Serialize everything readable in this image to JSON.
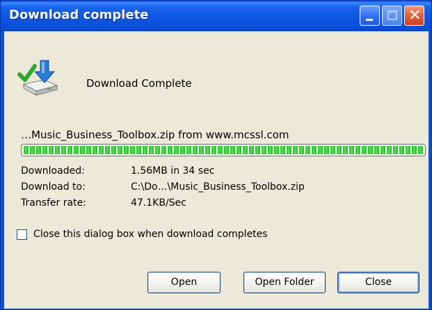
{
  "window": {
    "title": "Download complete",
    "controls": {
      "minimize_icon": "minimize-icon",
      "maximize_icon": "maximize-icon",
      "close_icon": "close-icon",
      "close_glyph": "✕"
    }
  },
  "dialog": {
    "icon": "download-complete-icon",
    "status": "Download Complete",
    "file_source": "…Music_Business_Toolbox.zip from www.mcssl.com",
    "progress": 1.0,
    "details": [
      {
        "label": "Downloaded:",
        "value": "1.56MB in 34 sec"
      },
      {
        "label": "Download to:",
        "value": "C:\\Do…\\Music_Business_Toolbox.zip"
      },
      {
        "label": "Transfer rate:",
        "value": "47.1KB/Sec"
      }
    ],
    "close_checkbox": {
      "label": "Close this dialog box when download completes",
      "checked": false
    },
    "buttons": {
      "open": "Open",
      "open_folder": "Open Folder",
      "close": "Close"
    }
  },
  "colors": {
    "titlebar": "#0a56e6",
    "client": "#ece9d8",
    "progress_green": "#27c227"
  }
}
